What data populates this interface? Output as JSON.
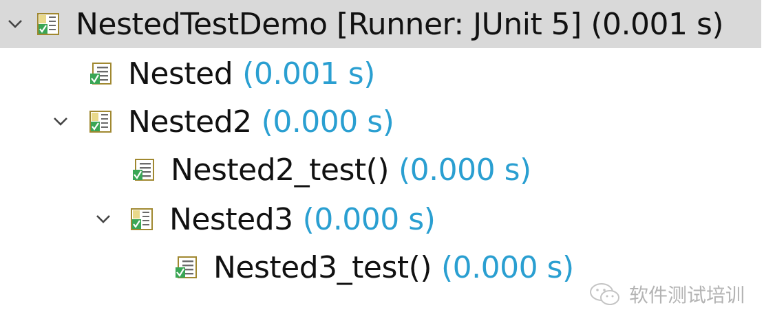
{
  "tree": {
    "root": {
      "label": "NestedTestDemo [Runner: JUnit 5] (0.001 s)",
      "icon": "test-suite-passed-icon",
      "expanded": true
    },
    "nodes": [
      {
        "label": "Nested",
        "time": "(0.001 s)",
        "icon": "test-suite-passed-icon"
      },
      {
        "label": "Nested2",
        "time": "(0.000 s)",
        "icon": "test-suite-passed-icon",
        "expanded": true
      },
      {
        "label": "Nested2_test()",
        "time": "(0.000 s)",
        "icon": "test-case-passed-icon"
      },
      {
        "label": "Nested3",
        "time": "(0.000 s)",
        "icon": "test-suite-passed-icon",
        "expanded": true
      },
      {
        "label": "Nested3_test()",
        "time": "(0.000 s)",
        "icon": "test-case-passed-icon"
      }
    ]
  },
  "watermark": {
    "text": "软件测试培训",
    "icon": "wechat-logo-icon"
  },
  "colors": {
    "time": "#2a9fd1",
    "selection": "#d9d9d9",
    "label": "#111111"
  }
}
